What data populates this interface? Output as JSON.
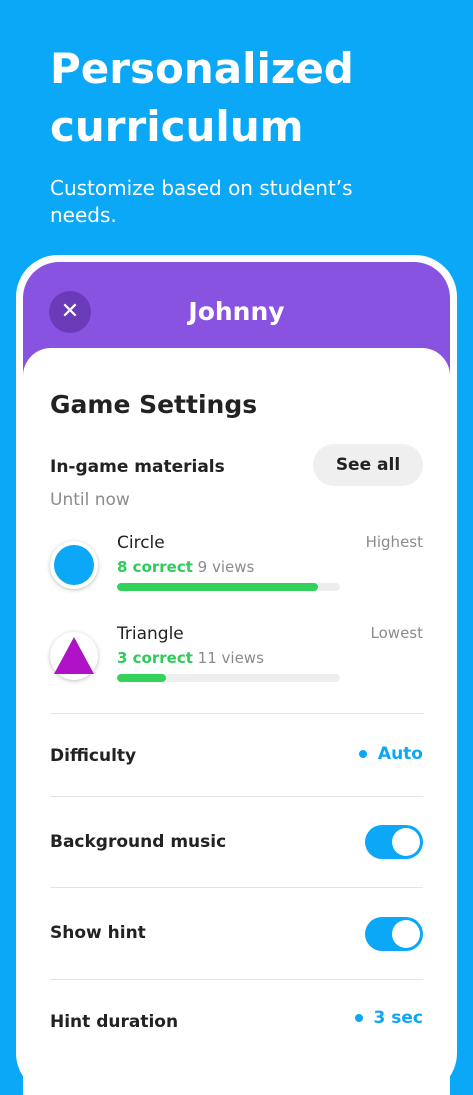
{
  "hero": {
    "title": "Personalized curriculum",
    "subtitle": "Customize based on student’s needs."
  },
  "header": {
    "close_icon": "close-icon",
    "user_name": "Johnny",
    "color": "#8753e0"
  },
  "settings": {
    "title": "Game Settings",
    "materials": {
      "label": "In-game materials",
      "see_all": "See all",
      "period": "Until now",
      "items": [
        {
          "name": "Circle",
          "rank": "Highest",
          "correct": "8 correct",
          "views": "9 views",
          "progress": 0.9,
          "icon": "circle-icon",
          "color": "#0aa8f6"
        },
        {
          "name": "Triangle",
          "rank": "Lowest",
          "correct": "3 correct",
          "views": "11 views",
          "progress": 0.22,
          "icon": "triangle-icon",
          "color": "#b012c8"
        }
      ]
    },
    "difficulty": {
      "label": "Difficulty",
      "value": "Auto"
    },
    "background_music": {
      "label": "Background music",
      "on": true
    },
    "show_hint": {
      "label": "Show hint",
      "on": true
    },
    "hint_duration": {
      "label": "Hint duration",
      "value": "3 sec"
    }
  },
  "colors": {
    "accent": "#0aa8f6",
    "success": "#34d15b"
  }
}
